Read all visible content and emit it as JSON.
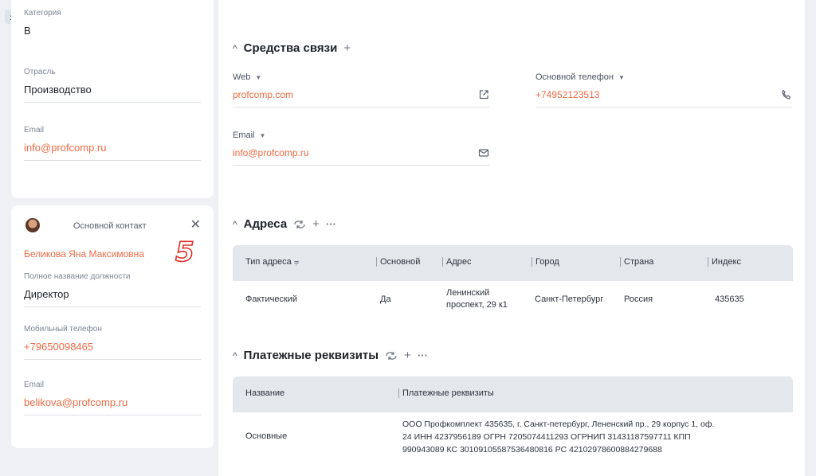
{
  "left_panel": {
    "expand_label": "»",
    "company_fields": [
      {
        "label": "Категория",
        "value": "B"
      },
      {
        "label": "Отрасль",
        "value": "Производство"
      },
      {
        "label": "Email",
        "value": "info@profcomp.ru"
      }
    ],
    "contact": {
      "title": "Основной контакт",
      "close_label": "✕",
      "name": "Беликова Яна Максимовна",
      "fields": [
        {
          "label": "Полное название должности",
          "value": "Директор"
        },
        {
          "label": "Мобильный телефон",
          "value": "+79650098465"
        },
        {
          "label": "Email",
          "value": "belikova@profcomp.ru"
        }
      ]
    },
    "step_number": "5"
  },
  "communications": {
    "title": "Средства связи",
    "caret": "^",
    "add_label": "+",
    "web": {
      "label": "Web",
      "value": "profcomp.com",
      "icon": "external-link-icon"
    },
    "phone": {
      "label": "Основной телефон",
      "value": "+74952123513",
      "icon": "phone-icon"
    },
    "email": {
      "label": "Email",
      "value": "info@profcomp.ru",
      "icon": "mail-icon"
    }
  },
  "addresses": {
    "title": "Адреса",
    "caret": "^",
    "add_label": "+",
    "more_label": "···",
    "columns": [
      "Тип адреса",
      "Основной",
      "Адрес",
      "Город",
      "Страна",
      "Индекс"
    ],
    "rows": [
      {
        "type": "Фактический",
        "primary": "Да",
        "address_line1": "Ленинский",
        "address_line2": "проспект, 29 к1",
        "city": "Санкт-Петербург",
        "country": "Россия",
        "index": "435635"
      }
    ]
  },
  "payments": {
    "title": "Платежные реквизиты",
    "caret": "^",
    "add_label": "+",
    "more_label": "···",
    "columns": [
      "Название",
      "Платежные реквизиты"
    ],
    "rows": [
      {
        "name": "Основные",
        "line1": "ООО Профкомплект 435635, г. Санкт-петербург, Лененский пр., 29 корпус 1, оф.",
        "line2": "24 ИНН 4237956189 ОГРН 7205074411293 ОГРНИП 31431187597711 КПП",
        "line3": "990943089 КС 30109105587536480816 РС 42102978600884279688"
      }
    ]
  },
  "colors": {
    "accent": "#ee6a43",
    "background": "#eef0f3",
    "table_header": "#e4e7ec"
  }
}
